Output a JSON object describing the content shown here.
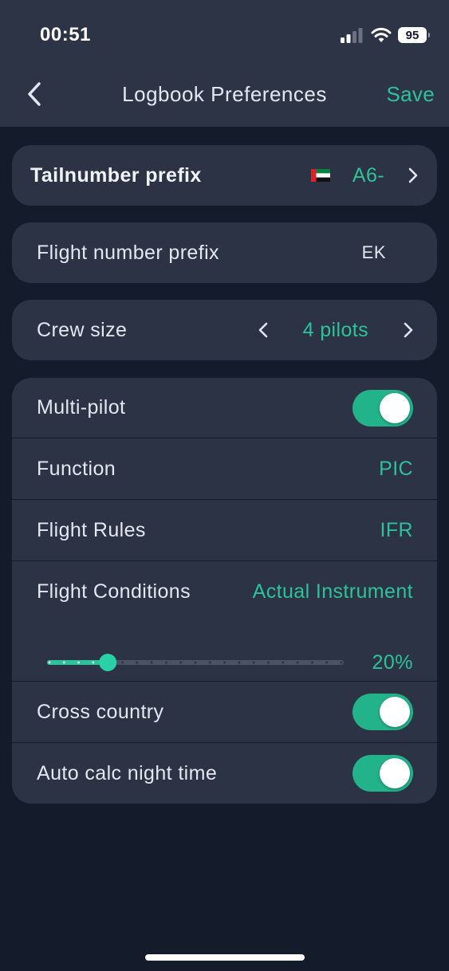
{
  "status": {
    "time": "00:51",
    "battery": "95"
  },
  "header": {
    "title": "Logbook Preferences",
    "save_label": "Save"
  },
  "tailnumber": {
    "label": "Tailnumber prefix",
    "value": "A6-",
    "flag_icon": "uae-flag-icon"
  },
  "flight_number": {
    "label": "Flight number prefix",
    "value": "EK"
  },
  "crew": {
    "label": "Crew size",
    "value": "4 pilots"
  },
  "settings": {
    "multi_pilot": {
      "label": "Multi-pilot",
      "on": true
    },
    "function": {
      "label": "Function",
      "value": "PIC"
    },
    "flight_rules": {
      "label": "Flight Rules",
      "value": "IFR"
    },
    "flight_conditions": {
      "label": "Flight Conditions",
      "value": "Actual Instrument",
      "percent_label": "20%",
      "percent": 20
    },
    "cross_country": {
      "label": "Cross country",
      "on": true
    },
    "auto_night": {
      "label": "Auto calc night time",
      "on": true
    }
  },
  "colors": {
    "accent": "#2ec29a",
    "card": "#2b3344",
    "background": "#141b2b",
    "header": "#2c3446"
  }
}
